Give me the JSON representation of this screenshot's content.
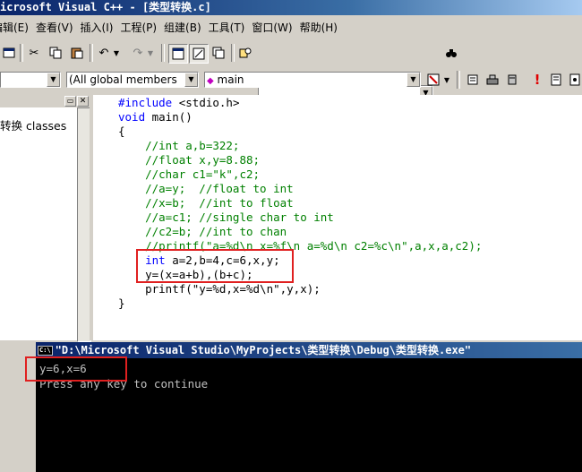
{
  "window": {
    "title": "icrosoft Visual C++ - [类型转换.c]"
  },
  "menu": {
    "items": [
      "编辑(E)",
      "查看(V)",
      "插入(I)",
      "工程(P)",
      "组建(B)",
      "工具(T)",
      "窗口(W)",
      "帮助(H)"
    ]
  },
  "toolbar2": {
    "class_combo": "(All global members",
    "member_combo": "main"
  },
  "left_pane": {
    "tree_label": "转换 classes"
  },
  "editor": {
    "lines": [
      {
        "t": "#include <stdio.h>",
        "c": "kw-include"
      },
      {
        "t": "void main()",
        "c": "void"
      },
      {
        "t": "{",
        "c": "plain"
      },
      {
        "t": "    //int a,b=322;",
        "c": "cm"
      },
      {
        "t": "    //float x,y=8.88;",
        "c": "cm"
      },
      {
        "t": "    //char c1=\"k\",c2;",
        "c": "cm"
      },
      {
        "t": "    //a=y;  //float to int",
        "c": "cm"
      },
      {
        "t": "    //x=b;  //int to float",
        "c": "cm"
      },
      {
        "t": "    //a=c1; //single char to int",
        "c": "cm"
      },
      {
        "t": "    //c2=b; //int to chan",
        "c": "cm"
      },
      {
        "t": "    //printf(\"a=%d\\n x=%f\\n a=%d\\n c2=%c\\n\",a,x,a,c2);",
        "c": "cm"
      },
      {
        "t": "    int a=2,b=4,c=6,x,y;",
        "c": "int"
      },
      {
        "t": "    y=(x=a+b),(b+c);",
        "c": "plain"
      },
      {
        "t": "    printf(\"y=%d,x=%d\\n\",y,x);",
        "c": "plain"
      },
      {
        "t": "}",
        "c": "plain"
      }
    ]
  },
  "console": {
    "title": "\"D:\\Microsoft Visual Studio\\MyProjects\\类型转换\\Debug\\类型转换.exe\"",
    "icon_label": "C:\\",
    "output_line": "y=6,x=6",
    "prompt_line": "Press any key to continue"
  },
  "colors": {
    "keyword": "#0000ff",
    "comment": "#008000",
    "highlight_box": "#e02020"
  }
}
